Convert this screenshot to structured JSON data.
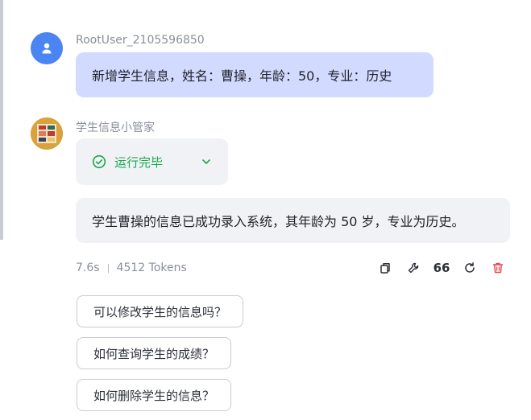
{
  "user_message": {
    "username": "RootUser_2105596850",
    "text": "新增学生信息，姓名：曹操，年龄：50，专业：历史",
    "avatar_icon": "user-icon",
    "avatar_color": "#4b84f3"
  },
  "bot_message": {
    "name": "学生信息小管家",
    "status_label": "运行完毕",
    "status_color": "#19a84a",
    "answer": "学生曹操的信息已成功录入系统，其年龄为 50 岁，专业为历史。",
    "duration": "7.6s",
    "tokens": "4512 Tokens",
    "quote_label": "66",
    "delete_color": "#e5484d"
  },
  "suggestions": [
    "可以修改学生的信息吗？",
    "如何查询学生的成绩？",
    "如何删除学生的信息？"
  ]
}
